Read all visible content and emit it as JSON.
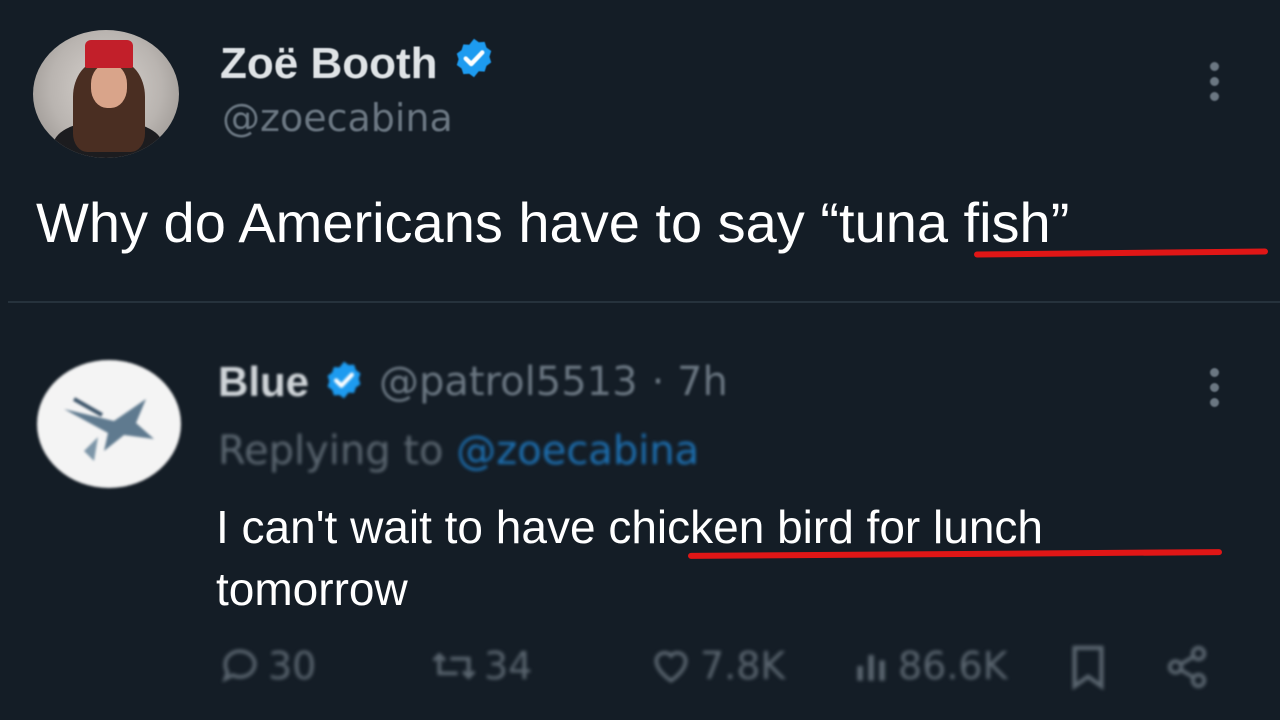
{
  "tweet": {
    "author_name": "Zoë Booth",
    "author_handle": "@zoecabina",
    "text_prefix": "Why do Americans have to say ",
    "text_highlight": "“tuna fish”",
    "verified_icon": "verified-badge-icon",
    "more_icon": "more-vertical-icon"
  },
  "reply": {
    "author_name": "Blue",
    "author_handle": "@patrol5513",
    "time": "· 7h",
    "replying_label": "Replying to",
    "replying_handle": "@zoecabina",
    "text_prefix": "I can't wait to have ",
    "text_highlight": "chicken bird for lunch",
    "text_suffix": " tomorrow",
    "avatar_icon": "swordfish-logo-icon"
  },
  "actions": {
    "replies": "30",
    "retweets": "34",
    "likes": "7.8K",
    "views": "86.6K"
  },
  "colors": {
    "background": "#141d26",
    "verified": "#1d9bf0",
    "underline": "#e01616",
    "muted": "#6b7782"
  }
}
